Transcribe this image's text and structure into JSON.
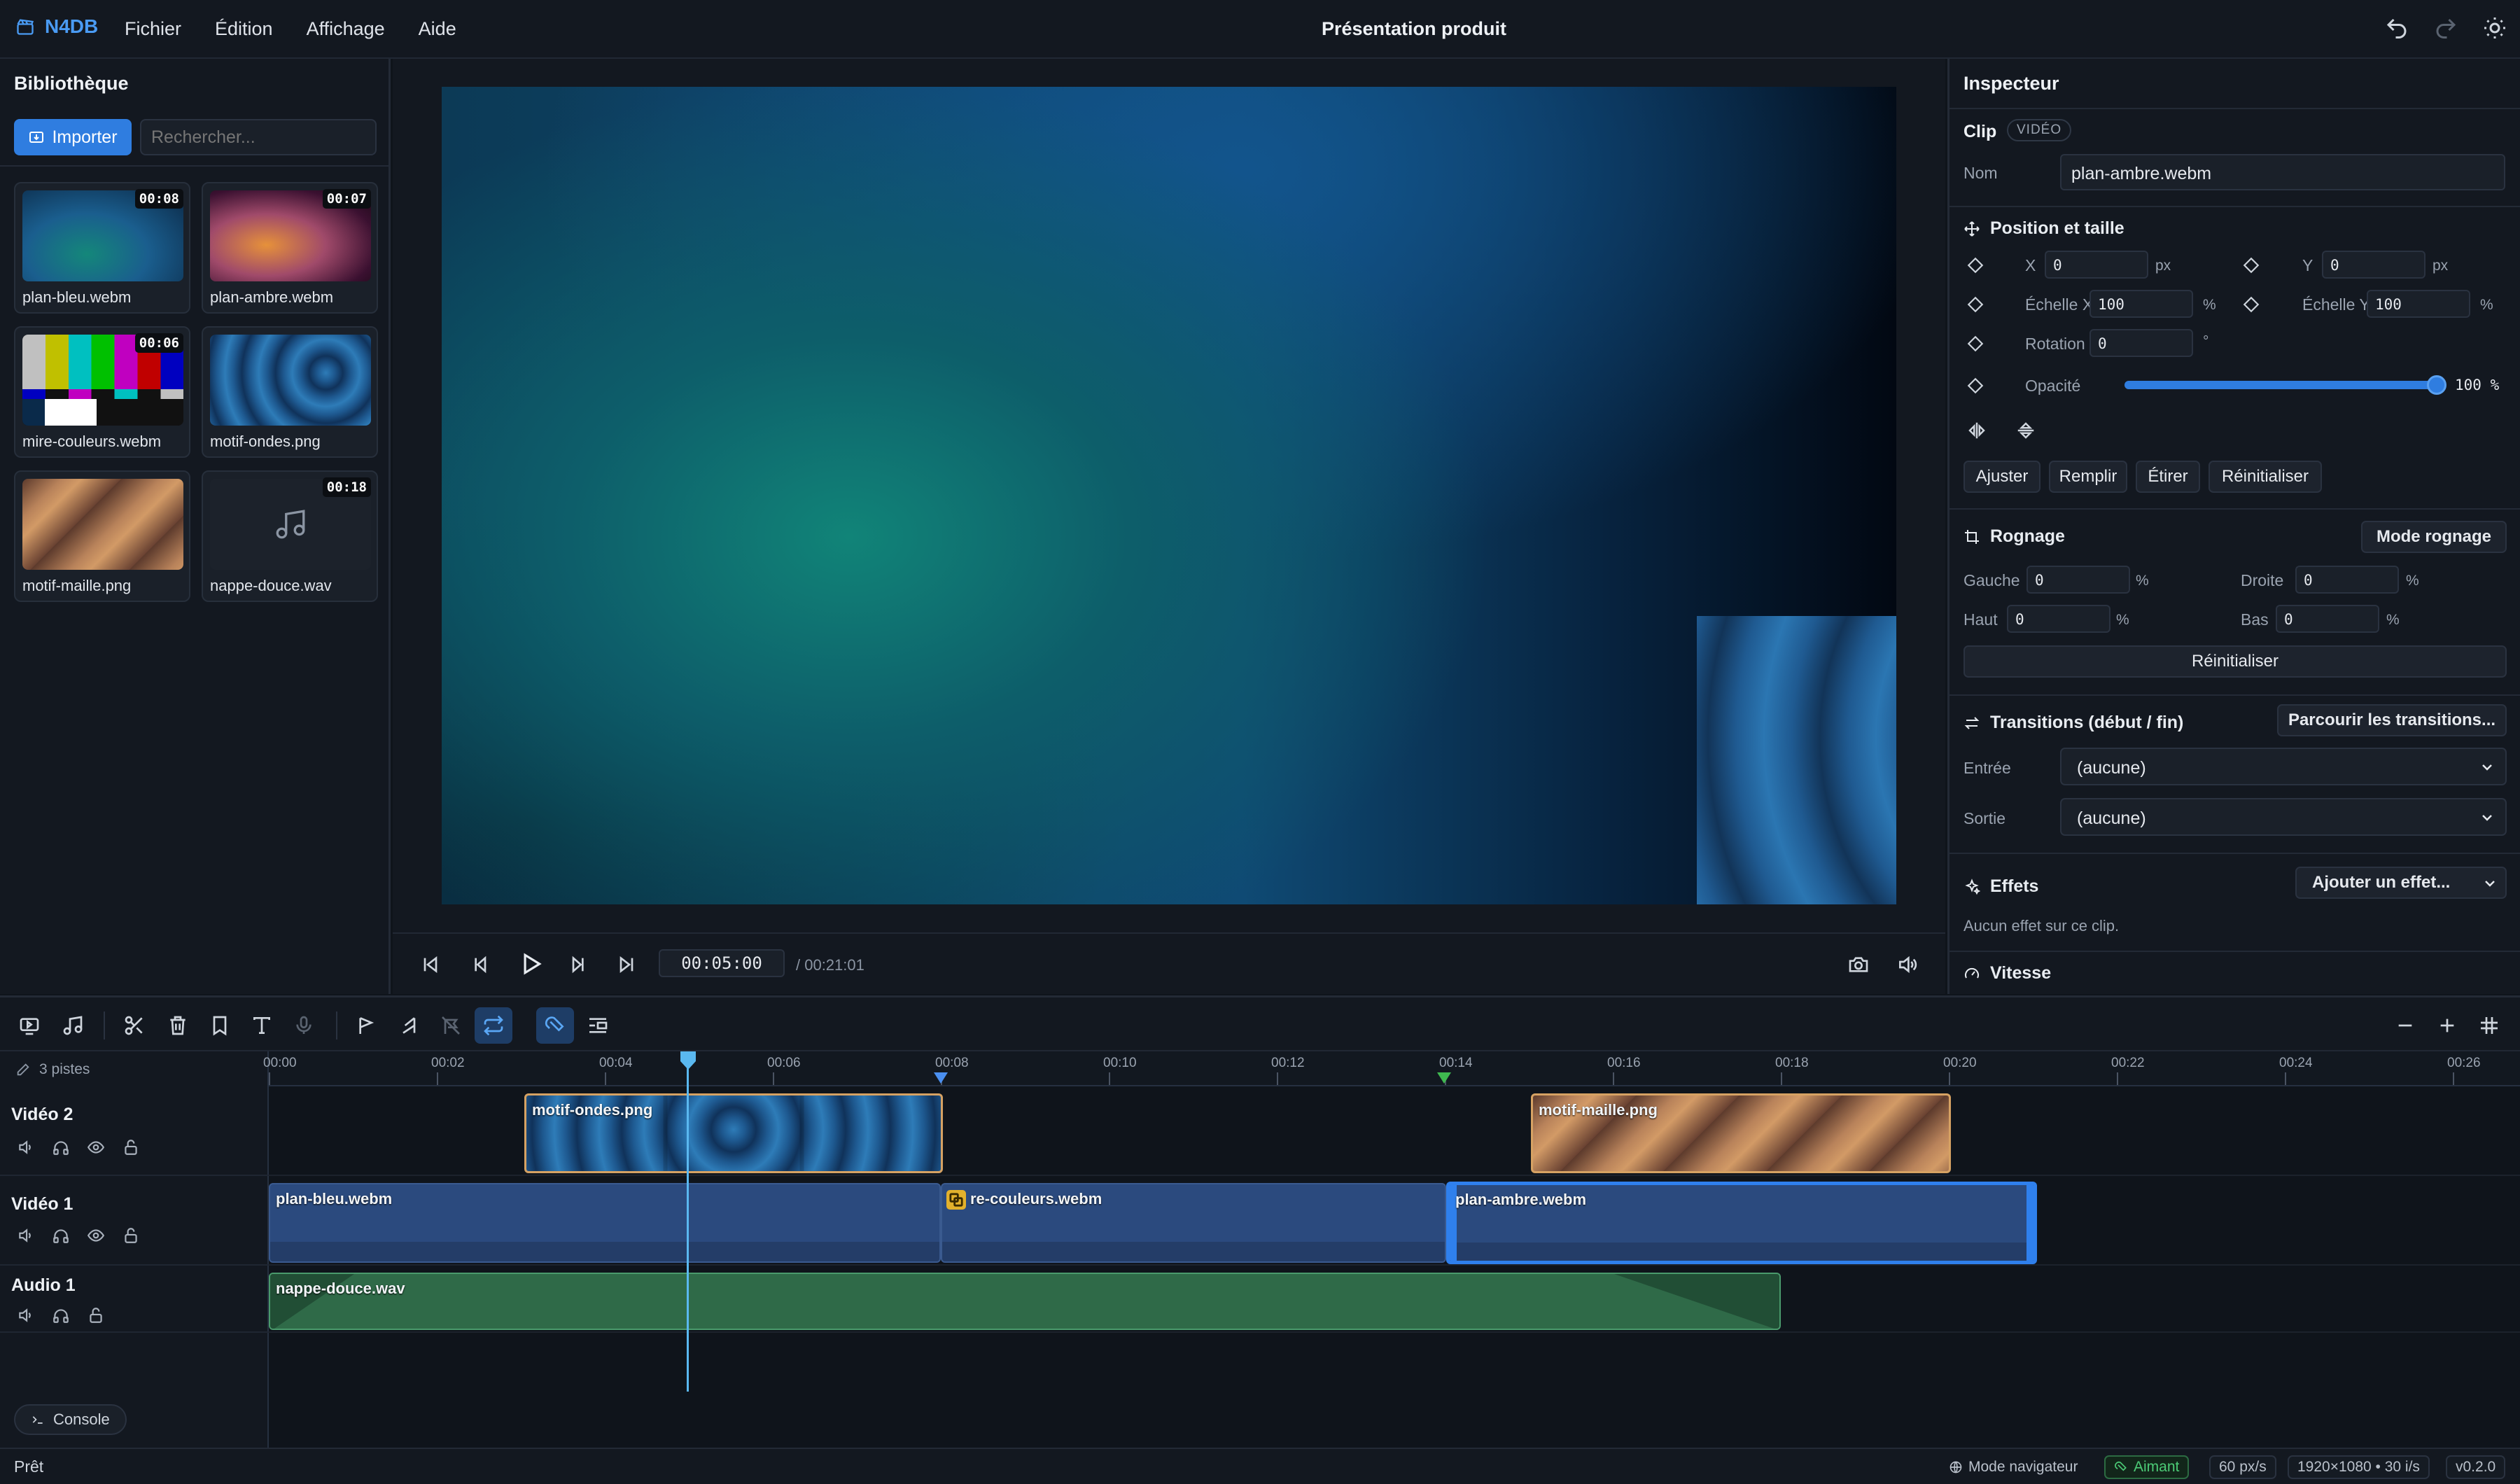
{
  "app": {
    "name": "N4DB",
    "title": "Présentation produit"
  },
  "menu": [
    "Fichier",
    "Édition",
    "Affichage",
    "Aide"
  ],
  "library": {
    "title": "Bibliothèque",
    "import_label": "Importer",
    "search_placeholder": "Rechercher...",
    "items": [
      {
        "name": "plan-bleu.webm",
        "duration": "00:08"
      },
      {
        "name": "plan-ambre.webm",
        "duration": "00:07"
      },
      {
        "name": "mire-couleurs.webm",
        "duration": "00:06"
      },
      {
        "name": "motif-ondes.png",
        "duration": ""
      },
      {
        "name": "motif-maille.png",
        "duration": ""
      },
      {
        "name": "nappe-douce.wav",
        "duration": "00:18"
      }
    ]
  },
  "player": {
    "timecode": "00:05:00",
    "total": "/ 00:21:01"
  },
  "inspector": {
    "title": "Inspecteur",
    "clip_label": "Clip",
    "clip_type": "VIDÉO",
    "name_label": "Nom",
    "name_value": "plan-ambre.webm",
    "position": {
      "title": "Position et taille",
      "x_label": "X",
      "x": "0",
      "x_unit": "px",
      "y_label": "Y",
      "y": "0",
      "y_unit": "px",
      "sx_label": "Échelle X",
      "sx": "100",
      "sx_unit": "%",
      "sy_label": "Échelle Y",
      "sy": "100",
      "sy_unit": "%",
      "rot_label": "Rotation",
      "rot": "0",
      "rot_unit": "°",
      "opacity_label": "Opacité",
      "opacity_value": "100 %",
      "opacity": 1.0,
      "buttons": [
        "Ajuster",
        "Remplir",
        "Étirer",
        "Réinitialiser"
      ]
    },
    "crop": {
      "title": "Rognage",
      "mode_button": "Mode rognage",
      "left_label": "Gauche",
      "left": "0",
      "right_label": "Droite",
      "right": "0",
      "top_label": "Haut",
      "top": "0",
      "bottom_label": "Bas",
      "bottom": "0",
      "unit": "%",
      "reset": "Réinitialiser"
    },
    "transitions": {
      "title": "Transitions (début / fin)",
      "browse": "Parcourir les transitions...",
      "in_label": "Entrée",
      "in_value": "(aucune)",
      "out_label": "Sortie",
      "out_value": "(aucune)"
    },
    "effects": {
      "title": "Effets",
      "add": "Ajouter un effet...",
      "empty": "Aucun effet sur ce clip."
    },
    "speed": {
      "title": "Vitesse"
    }
  },
  "timeline": {
    "track_count": "3 pistes",
    "ruler": [
      "00:00",
      "00:02",
      "00:04",
      "00:06",
      "00:08",
      "00:10",
      "00:12",
      "00:14",
      "00:16",
      "00:18",
      "00:20",
      "00:22",
      "00:24",
      "00:26"
    ],
    "tracks": [
      {
        "name": "Vidéo 2"
      },
      {
        "name": "Vidéo 1"
      },
      {
        "name": "Audio 1"
      }
    ],
    "clips": {
      "v2a": "motif-ondes.png",
      "v2b": "motif-maille.png",
      "v1a": "plan-bleu.webm",
      "v1b": "mire-couleurs.webm",
      "v1b_visible": "re-couleurs.webm",
      "v1c": "plan-ambre.webm",
      "a1": "nappe-douce.wav"
    },
    "console": "Console"
  },
  "status": {
    "text": "Prêt",
    "nav_mode": "Mode navigateur",
    "magnet": "Aimant",
    "zoom": "60 px/s",
    "format": "1920×1080 • 30 i/s",
    "version": "v0.2.0"
  },
  "colors": {
    "accent": "#2f7de0",
    "video_clip": "#2b4a7e",
    "image_clip": "#e3a95a",
    "audio_clip": "#2f6a48",
    "playhead": "#5ab8f0",
    "marker_green": "#3fb950"
  }
}
